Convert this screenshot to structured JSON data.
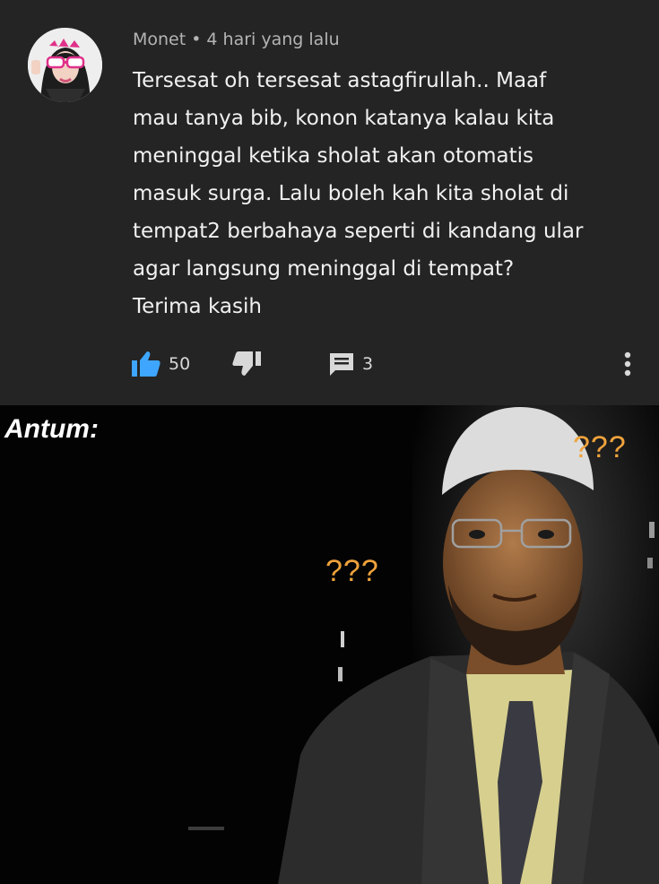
{
  "comment": {
    "author": "Monet",
    "separator": "•",
    "time": "4 hari yang lalu",
    "text_lines": [
      "Tersesat oh tersesat astagfirullah.. Maaf",
      "mau tanya bib, konon katanya kalau kita",
      "meninggal ketika sholat akan otomatis",
      "masuk surga. Lalu boleh kah kita sholat di",
      "tempat2 berbahaya seperti di kandang ular",
      "agar langsung meninggal di tempat?",
      "Terima kasih"
    ],
    "likes": "50",
    "replies": "3",
    "icons": {
      "like": "thumbs-up-icon",
      "dislike": "thumbs-down-icon",
      "reply": "comment-icon",
      "more": "more-vert-icon"
    },
    "colors": {
      "background": "#242424",
      "like_accent": "#3ea6ff",
      "text": "#f1f1f1",
      "meta": "#b4b4b4"
    }
  },
  "meme": {
    "caption": "Antum:",
    "qmarks_left": "???",
    "qmarks_right": "???",
    "colors": {
      "qmarks": "#f0a33c"
    }
  }
}
